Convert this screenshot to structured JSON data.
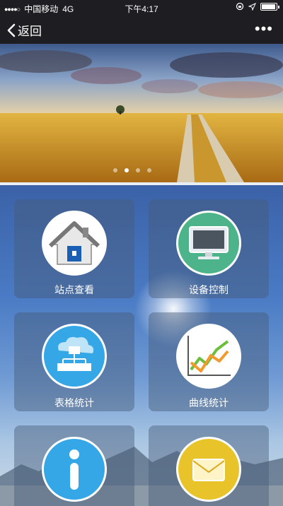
{
  "status": {
    "carrier": "中国移动",
    "network": "4G",
    "time": "下午4:17"
  },
  "nav": {
    "back_label": "返回",
    "more_label": "•••"
  },
  "banner": {
    "dots_total": 4,
    "active_dot": 1
  },
  "tiles": [
    {
      "label": "站点查看",
      "icon": "house-icon",
      "color": "#ffffff"
    },
    {
      "label": "设备控制",
      "icon": "monitor-icon",
      "color": "#4db38a"
    },
    {
      "label": "表格统计",
      "icon": "network-diagram-icon",
      "color": "#36a7e6"
    },
    {
      "label": "曲线统计",
      "icon": "line-chart-icon",
      "color": "#ffffff"
    },
    {
      "label": "",
      "icon": "info-icon",
      "color": "#36a7e6"
    },
    {
      "label": "",
      "icon": "mail-icon",
      "color": "#e8c32a"
    }
  ]
}
